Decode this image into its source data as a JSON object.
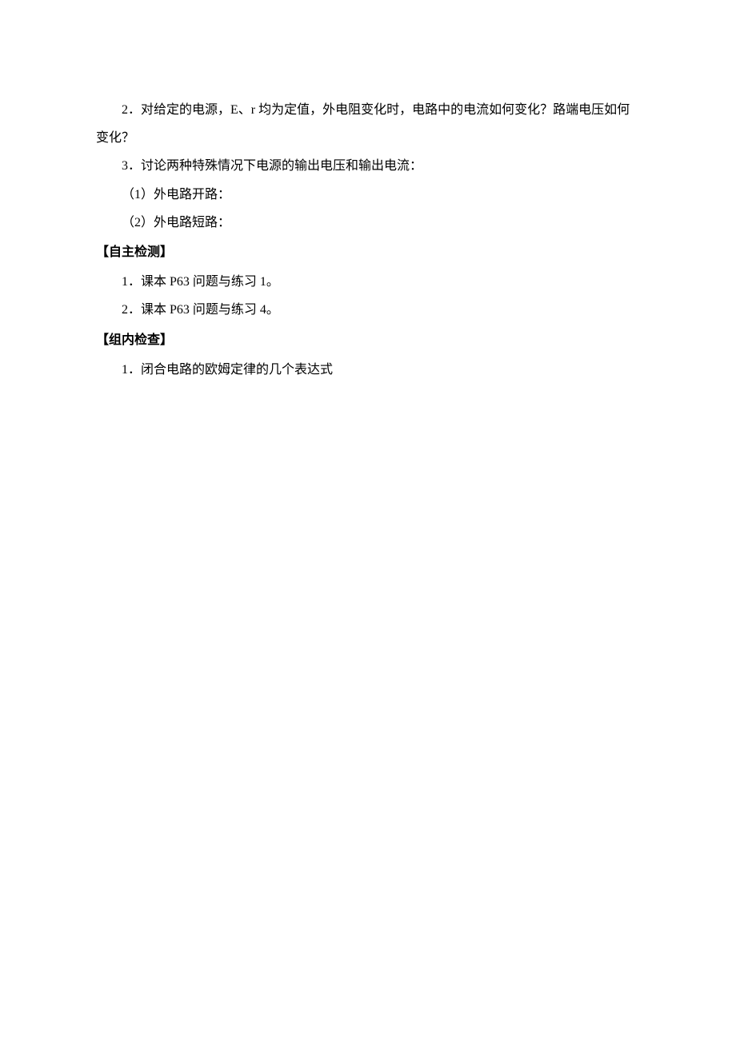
{
  "p1": "2．对给定的电源，E、r 均为定值，外电阻变化时，电路中的电流如何变化？路端电压如何变化？",
  "p2": "3．讨论两种特殊情况下电源的输出电压和输出电流：",
  "p3": "（1）外电路开路：",
  "p4": "（2）外电路短路：",
  "h1": "【自主检测】",
  "p5": "1．课本 P63 问题与练习 1。",
  "p6": "2．课本 P63 问题与练习 4。",
  "h2": "【组内检查】",
  "p7": "1．闭合电路的欧姆定律的几个表达式"
}
